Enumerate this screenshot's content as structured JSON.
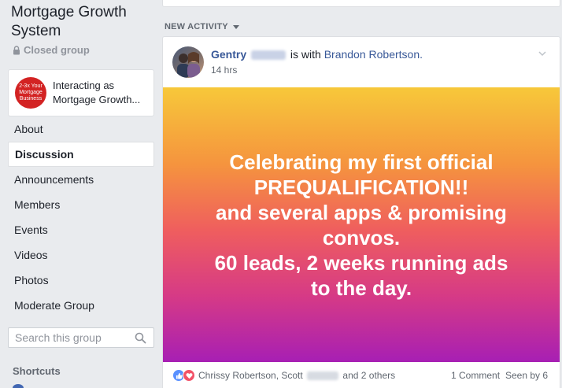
{
  "group": {
    "title": "Mortgage Growth System",
    "privacy": "Closed group"
  },
  "interacting": {
    "avatar_lines": [
      "2-3x Your",
      "Mortgage",
      "Business"
    ],
    "line1": "Interacting as",
    "line2": "Mortgage Growth..."
  },
  "nav": {
    "items": [
      {
        "label": "About"
      },
      {
        "label": "Discussion",
        "active": true
      },
      {
        "label": "Announcements"
      },
      {
        "label": "Members"
      },
      {
        "label": "Events"
      },
      {
        "label": "Videos"
      },
      {
        "label": "Photos"
      },
      {
        "label": "Moderate Group"
      }
    ]
  },
  "search": {
    "placeholder": "Search this group",
    "icon": "search-icon"
  },
  "shortcuts": {
    "heading": "Shortcuts"
  },
  "feed": {
    "section_label": "NEW ACTIVITY"
  },
  "post": {
    "author": "Gentry",
    "with_text": "is with",
    "with_name": "Brandon Robertson.",
    "time": "14 hrs",
    "banner_lines": [
      "Celebrating my first official",
      "PREQUALIFICATION!!",
      "and several apps & promising",
      "convos.",
      "60 leads, 2 weeks running ads",
      "to the day."
    ],
    "banner_colors": [
      "#f7c83a",
      "#f5943e",
      "#ef5e5e",
      "#d63a86",
      "#a71fb4"
    ],
    "reactions": {
      "icons": [
        "like-icon",
        "love-icon"
      ],
      "first": "Chrissy Robertson, Scott",
      "rest": "and 2 others"
    },
    "comments": "1 Comment",
    "seen": "Seen by 6"
  }
}
